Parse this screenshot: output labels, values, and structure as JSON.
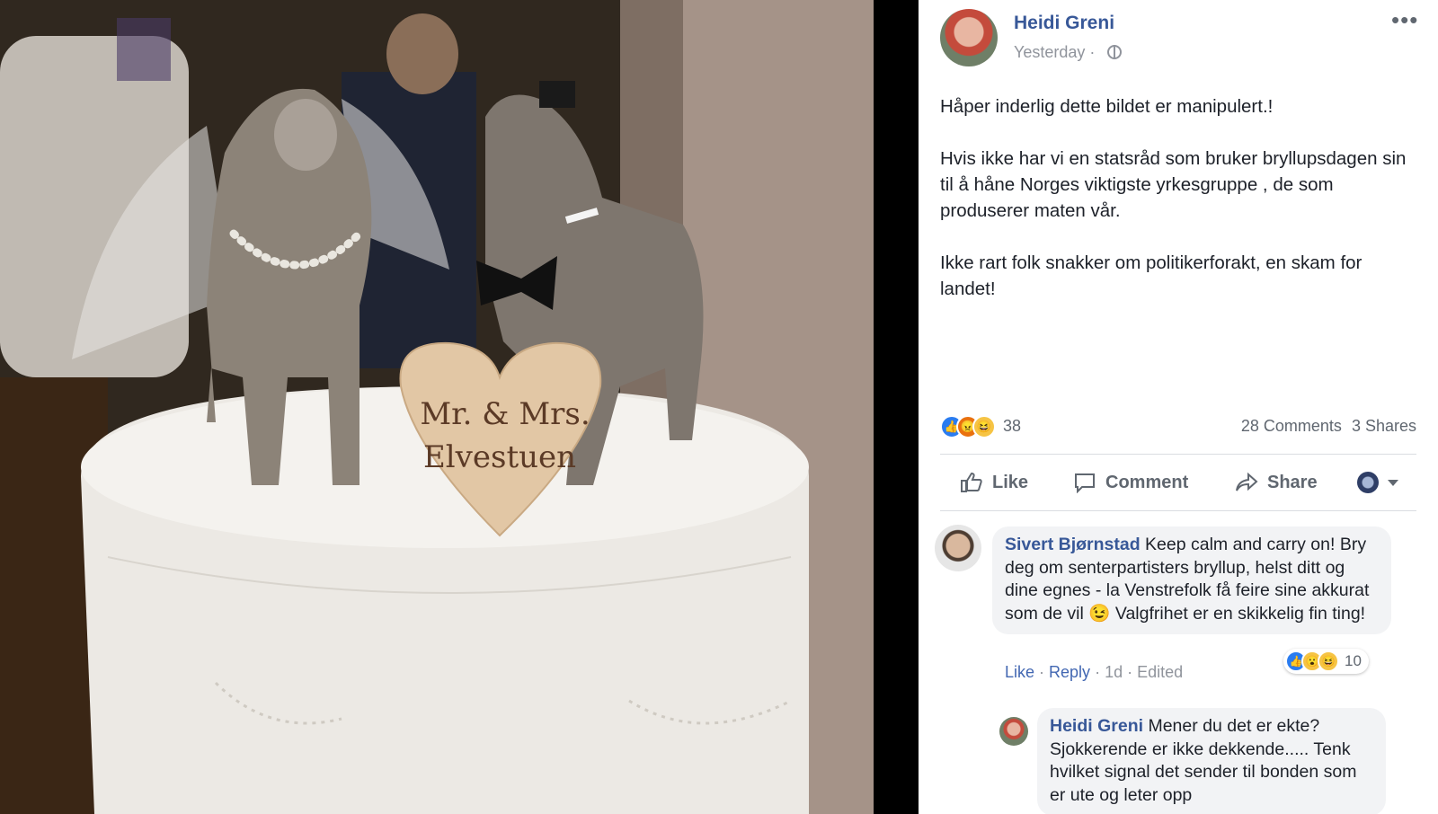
{
  "photo": {
    "topper_text": [
      "Mr. & Mrs.",
      "Elvestuen"
    ]
  },
  "post": {
    "author": "Heidi Greni",
    "timestamp": "Yesterday ·",
    "text": "Håper inderlig dette bildet er manipulert.!\n\nHvis ikke har vi en statsråd som bruker bryllupsdagen sin til å håne Norges viktigste yrkesgruppe , de som produserer maten vår.\n\nIkke rart folk snakker om politikerforakt, en skam for landet!",
    "reaction_count": "38",
    "comments_count": "28 Comments",
    "shares_count": "3 Shares",
    "reaction_icons": [
      "like",
      "angry",
      "haha"
    ]
  },
  "actions": {
    "like": "Like",
    "comment": "Comment",
    "share": "Share"
  },
  "comments": [
    {
      "author": "Sivert Bjørnstad",
      "text": "Keep calm and carry on! Bry deg om senterpartisters bryllup, helst ditt og dine egnes - la Venstrefolk få feire sine akkurat som de vil 😉 Valgfrihet er en skikkelig fin ting!",
      "like": "Like",
      "reply": "Reply",
      "age": "1d",
      "edited": "Edited",
      "reaction_count": "10",
      "reaction_icons": [
        "like",
        "wow",
        "haha"
      ]
    },
    {
      "author": "Heidi Greni",
      "text": "Mener du det er ekte? Sjokkerende er ikke dekkende..... Tenk hvilket signal det sender til bonden som er ute og leter opp"
    }
  ],
  "colors": {
    "link": "#385898",
    "like_blue": "#2a7cf0",
    "muted": "#90949c"
  }
}
